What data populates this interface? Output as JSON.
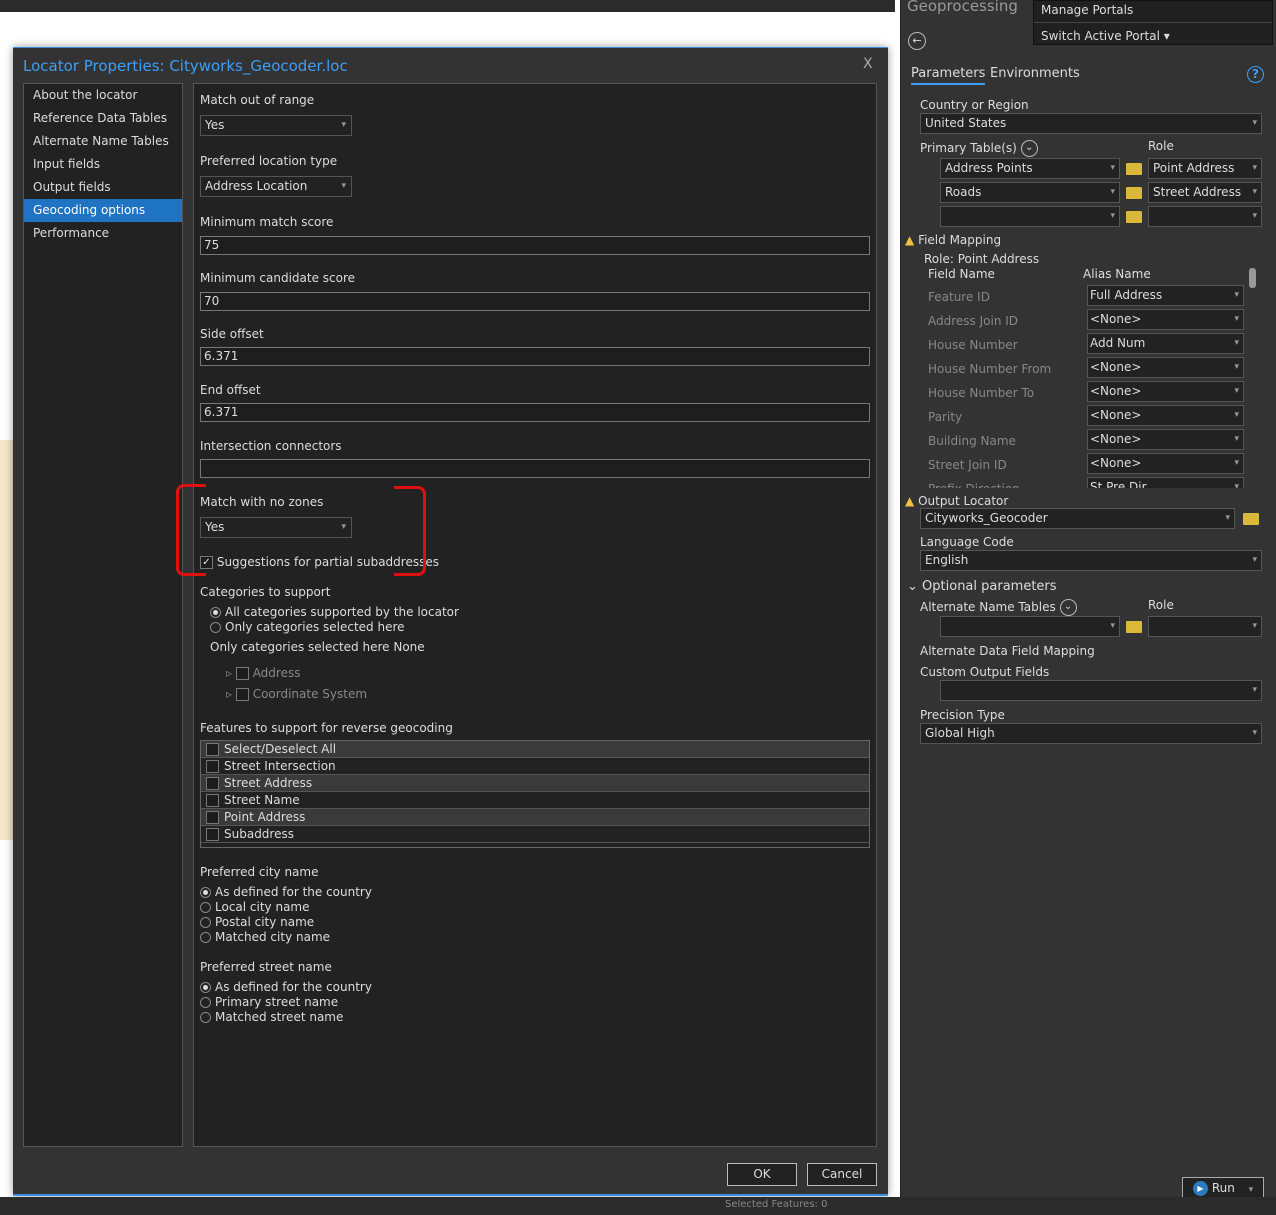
{
  "dialog": {
    "title": "Locator Properties: Cityworks_Geocoder.loc",
    "close": "X",
    "nav": [
      "About the locator",
      "Reference Data Tables",
      "Alternate Name Tables",
      "Input fields",
      "Output fields",
      "Geocoding options",
      "Performance"
    ],
    "nav_selected": "Geocoding options",
    "match_out_of_range": {
      "label": "Match out of range",
      "value": "Yes"
    },
    "preferred_location_type": {
      "label": "Preferred location type",
      "value": "Address Location"
    },
    "min_match_score": {
      "label": "Minimum match score",
      "value": "75"
    },
    "min_candidate_score": {
      "label": "Minimum candidate score",
      "value": "70"
    },
    "side_offset": {
      "label": "Side offset",
      "value": "6.371"
    },
    "end_offset": {
      "label": "End offset",
      "value": "6.371"
    },
    "intersection_connectors": {
      "label": "Intersection connectors",
      "value": ""
    },
    "match_no_zones": {
      "label": "Match with no zones",
      "value": "Yes"
    },
    "partial_subaddresses": {
      "label": "Suggestions for partial subaddresses",
      "checked": true
    },
    "categories": {
      "label": "Categories to support",
      "options": [
        "All categories supported by the locator",
        "Only categories selected here"
      ],
      "selected": 0,
      "summary": "Only categories selected here None",
      "tree": [
        "Address",
        "Coordinate System"
      ]
    },
    "reverse": {
      "label": "Features to support for reverse geocoding",
      "items": [
        "Select/Deselect All",
        "Street Intersection",
        "Street Address",
        "Street Name",
        "Point Address",
        "Subaddress"
      ]
    },
    "city_name": {
      "label": "Preferred city name",
      "options": [
        "As defined for the country",
        "Local city name",
        "Postal city name",
        "Matched city name"
      ],
      "selected": 0
    },
    "street_name": {
      "label": "Preferred street name",
      "options": [
        "As defined for the country",
        "Primary street name",
        "Matched street name"
      ],
      "selected": 0
    },
    "ok": "OK",
    "cancel": "Cancel"
  },
  "panel": {
    "title": "Geoprocessing",
    "menu": [
      "Manage Portals",
      "Switch Active Portal ▾"
    ],
    "tabs": [
      "Parameters",
      "Environments"
    ],
    "help": "?",
    "country_label": "Country or Region",
    "country": "United States",
    "primary_label": "Primary Table(s)",
    "role_label": "Role",
    "primary": [
      {
        "table": "Address Points",
        "role": "Point Address"
      },
      {
        "table": "Roads",
        "role": "Street Address"
      },
      {
        "table": "",
        "role": ""
      }
    ],
    "field_mapping": "Field Mapping",
    "fm_role": "Role: Point Address",
    "fm_field_col": "Field Name",
    "fm_alias_col": "Alias Name",
    "fm_rows": [
      [
        "Feature ID",
        "Full Address"
      ],
      [
        "Address Join ID",
        "<None>"
      ],
      [
        "House Number",
        "Add Num"
      ],
      [
        "House Number From",
        "<None>"
      ],
      [
        "House Number To",
        "<None>"
      ],
      [
        "Parity",
        "<None>"
      ],
      [
        "Building Name",
        "<None>"
      ],
      [
        "Street Join ID",
        "<None>"
      ],
      [
        "Prefix Direction",
        "St Pre Dir"
      ]
    ],
    "output_label": "Output Locator",
    "output": "Cityworks_Geocoder",
    "lang_label": "Language Code",
    "lang": "English",
    "optional": "Optional parameters",
    "alt_label": "Alternate Name Tables",
    "alt_role_label": "Role",
    "alt_mapping": "Alternate Data Field Mapping",
    "custom_label": "Custom Output Fields",
    "precision_label": "Precision Type",
    "precision": "Global High",
    "run": "Run"
  },
  "status": {
    "selected": "Selected Features: 0"
  },
  "colors": {
    "accent": "#3d9ef5",
    "selection": "#1e73c2",
    "annotation": "#e01010",
    "folder": "#d9b83a"
  }
}
